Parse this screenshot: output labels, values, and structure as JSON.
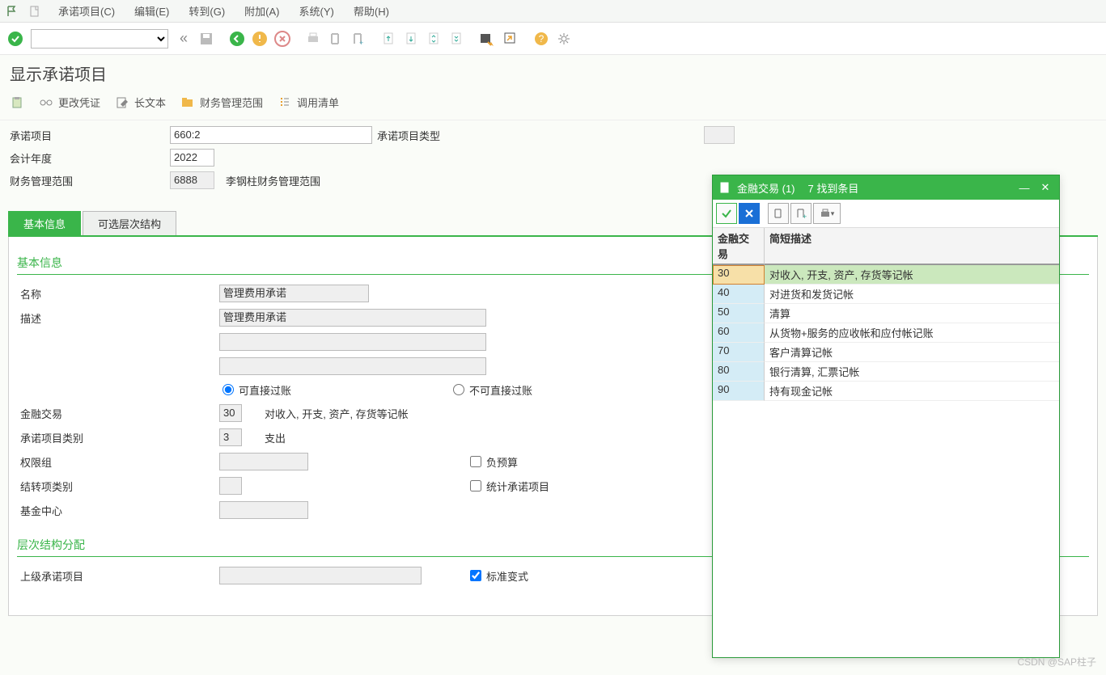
{
  "menu": {
    "items": [
      "承诺项目(C)",
      "编辑(E)",
      "转到(G)",
      "附加(A)",
      "系统(Y)",
      "帮助(H)"
    ]
  },
  "title": "显示承诺项目",
  "subtoolbar": {
    "change_doc": "更改凭证",
    "long_text": "长文本",
    "fm_area": "财务管理范围",
    "call_list": "调用清单"
  },
  "header_fields": {
    "commit_item_label": "承诺项目",
    "commit_item_value": "660:2",
    "commit_item_type_label": "承诺项目类型",
    "commit_item_type_value": "",
    "fiscal_year_label": "会计年度",
    "fiscal_year_value": "2022",
    "fm_area_label": "财务管理范围",
    "fm_area_value": "6888",
    "fm_area_desc": "李钢柱财务管理范围"
  },
  "tabs": {
    "t1": "基本信息",
    "t2": "可选层次结构"
  },
  "group1": {
    "title": "基本信息",
    "name_label": "名称",
    "name_value": "管理费用承诺",
    "desc_label": "描述",
    "desc_value": "管理费用承诺",
    "radio_direct": "可直接过账",
    "radio_not_direct": "不可直接过账",
    "fin_tx_label": "金融交易",
    "fin_tx_value": "30",
    "fin_tx_desc": "对收入, 开支, 资产, 存货等记帐",
    "cat_label": "承诺项目类别",
    "cat_value": "3",
    "cat_desc": "支出",
    "authgrp_label": "权限组",
    "chk_neg_budget": "负预算",
    "carryfwd_label": "结转项类别",
    "chk_stat": "统计承诺项目",
    "fund_center_label": "基金中心"
  },
  "group2": {
    "title": "层次结构分配",
    "parent_label": "上级承诺项目",
    "chk_std_variant": "标准变式"
  },
  "popup": {
    "title": "金融交易 (1)",
    "found": "7 找到条目",
    "col1": "金融交易",
    "col2": "简短描述",
    "rows": [
      {
        "code": "30",
        "desc": "对收入, 开支, 资产, 存货等记帐"
      },
      {
        "code": "40",
        "desc": "对进货和发货记帐"
      },
      {
        "code": "50",
        "desc": "清算"
      },
      {
        "code": "60",
        "desc": "从货物+服务的应收帐和应付帐记账"
      },
      {
        "code": "70",
        "desc": "客户清算记帐"
      },
      {
        "code": "80",
        "desc": "银行清算, 汇票记帐"
      },
      {
        "code": "90",
        "desc": "持有现金记帐"
      }
    ]
  },
  "watermark": "CSDN @SAP柱子"
}
